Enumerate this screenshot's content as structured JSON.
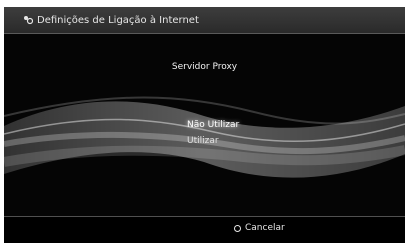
{
  "titlebar": {
    "title": "Definições de Ligação à Internet",
    "icon": "network-settings-icon"
  },
  "dialog": {
    "heading": "Servidor Proxy",
    "options": [
      {
        "label": "Não Utilizar",
        "selected": true
      },
      {
        "label": "Utilizar",
        "selected": false
      }
    ]
  },
  "footer": {
    "cancel_label": "Cancelar",
    "cancel_icon": "circle-button-icon"
  }
}
